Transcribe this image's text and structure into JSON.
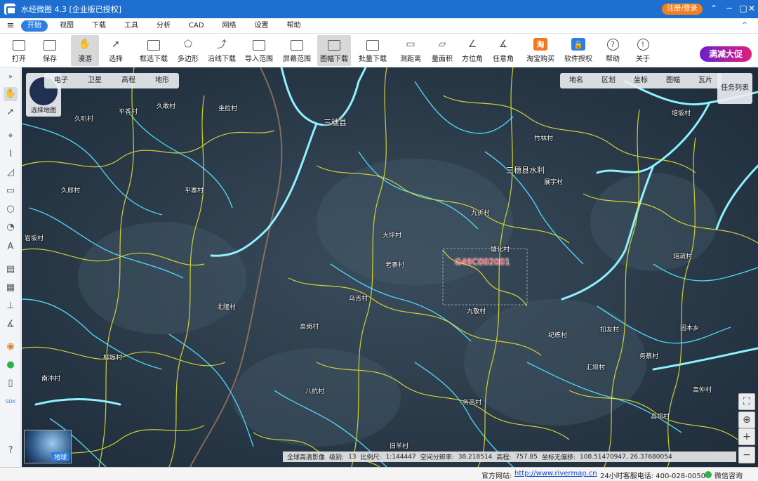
{
  "window": {
    "title": "水经微图 4.3 [企业版已授权]",
    "login_label": "注册/登录",
    "controls": [
      "⌃",
      "─",
      "□",
      "✕"
    ]
  },
  "menu": {
    "items": [
      "开始",
      "视图",
      "下载",
      "工具",
      "分析",
      "CAD",
      "网络",
      "设置",
      "帮助"
    ],
    "active": "开始"
  },
  "toolbar": {
    "items": [
      {
        "label": "打开",
        "icon": "folder-icon"
      },
      {
        "label": "保存",
        "icon": "save-icon"
      },
      {
        "label": "漫游",
        "icon": "hand-icon"
      },
      {
        "label": "选择",
        "icon": "cursor-icon"
      },
      {
        "label": "框选下载",
        "icon": "box-download-icon"
      },
      {
        "label": "多边形",
        "icon": "polygon-icon"
      },
      {
        "label": "沿线下载",
        "icon": "line-download-icon"
      },
      {
        "label": "导入范围",
        "icon": "import-icon"
      },
      {
        "label": "屏幕范围",
        "icon": "screen-icon"
      },
      {
        "label": "图幅下载",
        "icon": "sheet-download-icon"
      },
      {
        "label": "批量下载",
        "icon": "batch-download-icon"
      },
      {
        "label": "测距离",
        "icon": "ruler-icon"
      },
      {
        "label": "量面积",
        "icon": "area-icon"
      },
      {
        "label": "方位角",
        "icon": "azimuth-icon"
      },
      {
        "label": "任意角",
        "icon": "angle-icon"
      },
      {
        "label": "淘宝购买",
        "icon": "taobao-icon"
      },
      {
        "label": "软件授权",
        "icon": "license-icon"
      },
      {
        "label": "帮助",
        "icon": "help-icon"
      },
      {
        "label": "关于",
        "icon": "info-icon"
      }
    ],
    "promo": "满减大促"
  },
  "map": {
    "basemap_tabs": [
      "电子",
      "卫星",
      "高程",
      "地形"
    ],
    "layer_tabs": [
      "地名",
      "区划",
      "坐标",
      "图幅",
      "瓦片"
    ],
    "task_list": "任务列表",
    "select_map": "选择地图",
    "globe_label": "地球",
    "sheet_number": "G49C002001",
    "place_labels": [
      "坐拉村",
      "久叭村",
      "平寨村",
      "久敢村",
      "平香村",
      "久郎村",
      "岩坂村",
      "大坪村",
      "老寨村",
      "乌吉村",
      "北隆村",
      "高岗村",
      "柳坂村",
      "南冲村",
      "八抗村",
      "务苗村",
      "旧羊村",
      "塘化村",
      "培疏村",
      "纪栋村",
      "扣友村",
      "固本乡",
      "务蔡村",
      "高仲村",
      "培坂村",
      "九折村",
      "竹林村",
      "展宇村",
      "三穗县水利",
      "九敬村",
      "高坝村",
      "汇坝村",
      "三穗县"
    ]
  },
  "info_bar": {
    "imagery": "全球高清影像",
    "level_label": "级别:",
    "level": "13",
    "scale_label": "比例尺:",
    "scale": "1:144447",
    "resolution_label": "空间分辨率:",
    "resolution": "38.218514",
    "elevation_label": "高程:",
    "elevation": "757.85",
    "coord_label": "坐标无偏移:",
    "coords": "108.51470947, 26.37680054"
  },
  "status_bar": {
    "website_label": "官方网站:",
    "website": "http://www.rivermap.cn",
    "hotline": "24小时客服电话: 400-028-0050",
    "wechat": "微信咨询"
  }
}
